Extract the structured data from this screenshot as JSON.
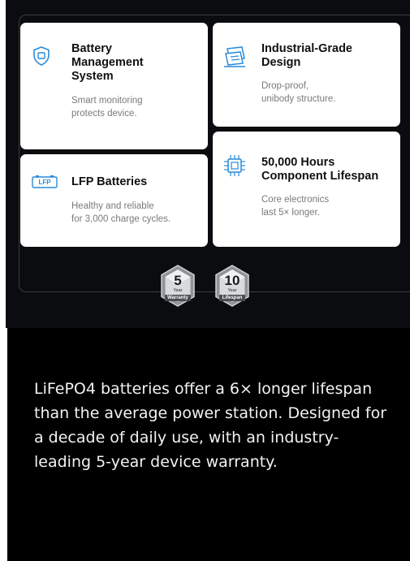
{
  "features": [
    {
      "icon": "shield-icon",
      "title": "Battery\nManagement\nSystem",
      "desc": "Smart monitoring\nprotects device."
    },
    {
      "icon": "pcb-layers-icon",
      "title": "Industrial-Grade\nDesign",
      "desc": "Drop-proof,\nunibody structure."
    },
    {
      "icon": "lfp-battery-icon",
      "icon_text": "LFP",
      "title": "LFP Batteries",
      "desc": "Healthy and reliable\nfor 3,000 charge cycles."
    },
    {
      "icon": "chip-icon",
      "title": "50,000 Hours\nComponent Lifespan",
      "desc": "Core electronics\nlast 5× longer."
    }
  ],
  "badges": [
    {
      "icon": "warranty-badge",
      "number": "5",
      "unit": "Year",
      "label": "Warranty"
    },
    {
      "icon": "lifespan-badge",
      "number": "10",
      "unit": "Year",
      "label": "Lifespan"
    }
  ],
  "body_text": "LiFePO4 batteries offer a 6× longer lifespan than the average power station. Designed for a decade of daily use, with an industry-leading 5-year device warranty.",
  "colors": {
    "accent": "#2a8ad8",
    "panel": "#0b0c0f",
    "card": "#ffffff"
  }
}
